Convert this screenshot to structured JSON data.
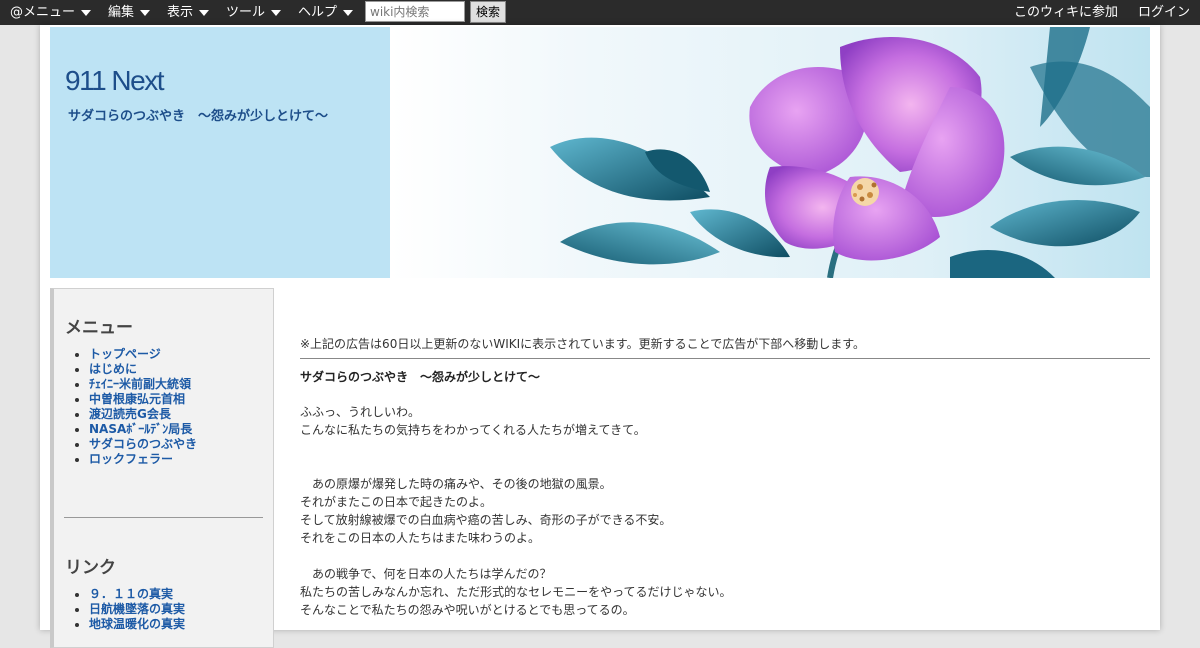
{
  "topbar": {
    "menu": [
      {
        "label": "@メニュー"
      },
      {
        "label": "編集"
      },
      {
        "label": "表示"
      },
      {
        "label": "ツール"
      },
      {
        "label": "ヘルプ"
      }
    ],
    "search": {
      "placeholder": "wiki内検索",
      "value": "",
      "button_label": "検索"
    },
    "join_label": "このウィキに参加",
    "login_label": "ログイン"
  },
  "header": {
    "title": "911 Next",
    "subtitle": "サダコらのつぶやき　～怨みが少しとけて～"
  },
  "sidebar": {
    "menu_heading": "メニュー",
    "menu_items": [
      {
        "label": "トップページ"
      },
      {
        "label": "はじめに"
      },
      {
        "label": "ﾁｪｲﾆｰ米前副大統領"
      },
      {
        "label": "中曽根康弘元首相"
      },
      {
        "label": "渡辺読売G会長"
      },
      {
        "label": "NASAﾎﾞｰﾙﾃﾞﾝ局長"
      },
      {
        "label": "サダコらのつぶやき"
      },
      {
        "label": "ロックフェラー"
      }
    ],
    "links_heading": "リンク",
    "link_items": [
      {
        "label": "９．１１の真実"
      },
      {
        "label": "日航機墜落の真実"
      },
      {
        "label": "地球温暖化の真実"
      }
    ]
  },
  "main": {
    "notice": "※上記の広告は60日以上更新のないWIKIに表示されています。更新することで広告が下部へ移動します。",
    "post_title": "サダコらのつぶやき　～怨みが少しとけて～",
    "lines": [
      "ふふっ、うれしいわ。",
      "こんなに私たちの気持ちをわかってくれる人たちが増えてきて。",
      "　あの原爆が爆発した時の痛みや、その後の地獄の風景。",
      "それがまたこの日本で起きたのよ。",
      "そして放射線被爆での白血病や癌の苦しみ、奇形の子ができる不安。",
      "それをこの日本の人たちはまた味わうのよ。",
      "　あの戦争で、何を日本の人たちは学んだの？",
      "私たちの苦しみなんか忘れ、ただ形式的なセレモニーをやってるだけじゃない。",
      "そんなことで私たちの怨みや呪いがとけるとでも思ってるの。"
    ]
  },
  "colors": {
    "topbar_bg": "#2b2b2b",
    "header_left_bg": "#bde3f4",
    "title_color": "#1d4e8a",
    "link_color": "#1d5aa6"
  },
  "icons": [
    "dropdown-caret-icon"
  ]
}
